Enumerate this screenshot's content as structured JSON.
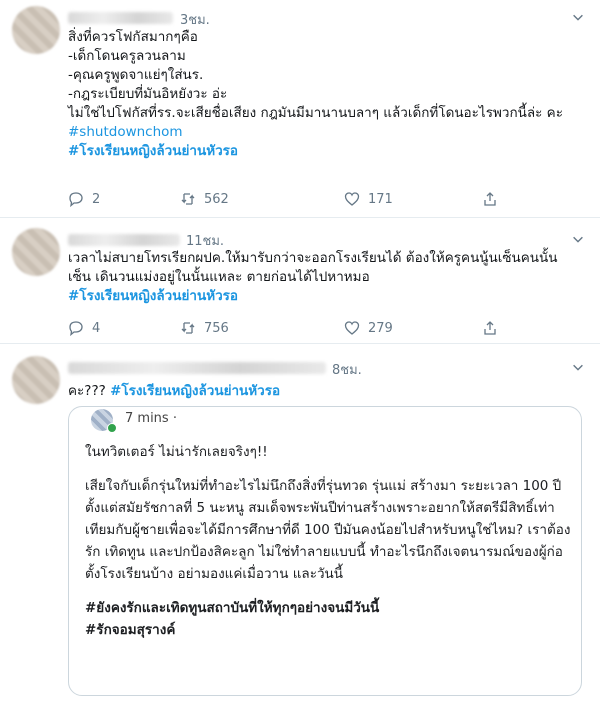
{
  "tweets": [
    {
      "time": "3ชม.",
      "lines": [
        "สิ่งที่ควรโฟกัสมากๆคือ",
        "-เด็กโดนครูลวนลาม",
        "-คุณครูพูดจาแย่ๆใส่นร.",
        "-กฎระเบียบที่มันอิหยังวะ อ่ะ",
        "ไม่ใช่ไปโฟกัสที่รร.จะเสียชื่อเสียง กฎมันมีมานานบลาๆ แล้วเด็กที่โดนอะไรพวกนี้ล่ะ คะ"
      ],
      "hashtag_en": "#shutdownchom",
      "hashtag_th": "#โรงเรียนหญิงล้วนย่านหัวรอ",
      "replies": "2",
      "retweets": "562",
      "likes": "171"
    },
    {
      "time": "11ชม.",
      "lines": [
        "เวลาไม่สบายโทรเรียกผปค.ให้มารับกว่าจะออกโรงเรียนได้ ต้องให้ครูคนนู้นเซ็นคนนั้นเซ็น เดินวนแม่งอยู่ในนั้นแหละ ตายก่อนได้ไปหาหมอ"
      ],
      "hashtag_th": "#โรงเรียนหญิงล้วนย่านหัวรอ",
      "replies": "4",
      "retweets": "756",
      "likes": "279"
    },
    {
      "time": "8ชม.",
      "prefix": "คะ???",
      "hashtag_th": "#โรงเรียนหญิงล้วนย่านหัวรอ",
      "card": {
        "time": "7 mins ·",
        "p1": "ในทวิตเตอร์ ไม่น่ารักเลยจริงๆ!!",
        "p2": "เสียใจกับเด็กรุ่นใหม่ที่ทำอะไรไม่นึกถึงสิ่งที่รุ่นทวด รุ่นแม่ สร้างมา ระยะเวลา 100 ปี ตั้งแต่สมัยรัชกาลที่ 5 นะหนู สมเด็จพระพันปีท่านสร้างเพราะอยากให้สตรีมีสิทธิ์เท่าเทียมกับผู้ชายเพื่อจะได้มีการศึกษาที่ดี 100 ปีมันคงน้อยไปสำหรับหนูใช่ไหม? เราต้องรัก เทิดทูน และปกป้องสิคะลูก ไม่ใช่ทำลายแบบนี้ ทำอะไรนึกถึงเจตนารมณ์ของผู้ก่อตั้งโรงเรียนบ้าง อย่ามองแค่เมื่อวาน และวันนี้",
        "hash1": "#ยังคงรักและเทิดทูนสถาบันที่ให้ทุกๆอย่างจนมีวันนี้",
        "hash2": "#รักจอมสุรางค์"
      }
    }
  ],
  "icons": {
    "reply": "reply-icon",
    "retweet": "retweet-icon",
    "like": "heart-icon",
    "share": "share-icon",
    "more": "chevron-down-icon"
  },
  "colors": {
    "link": "#1b95e0",
    "muted": "#657786",
    "border": "#e6ecf0"
  }
}
